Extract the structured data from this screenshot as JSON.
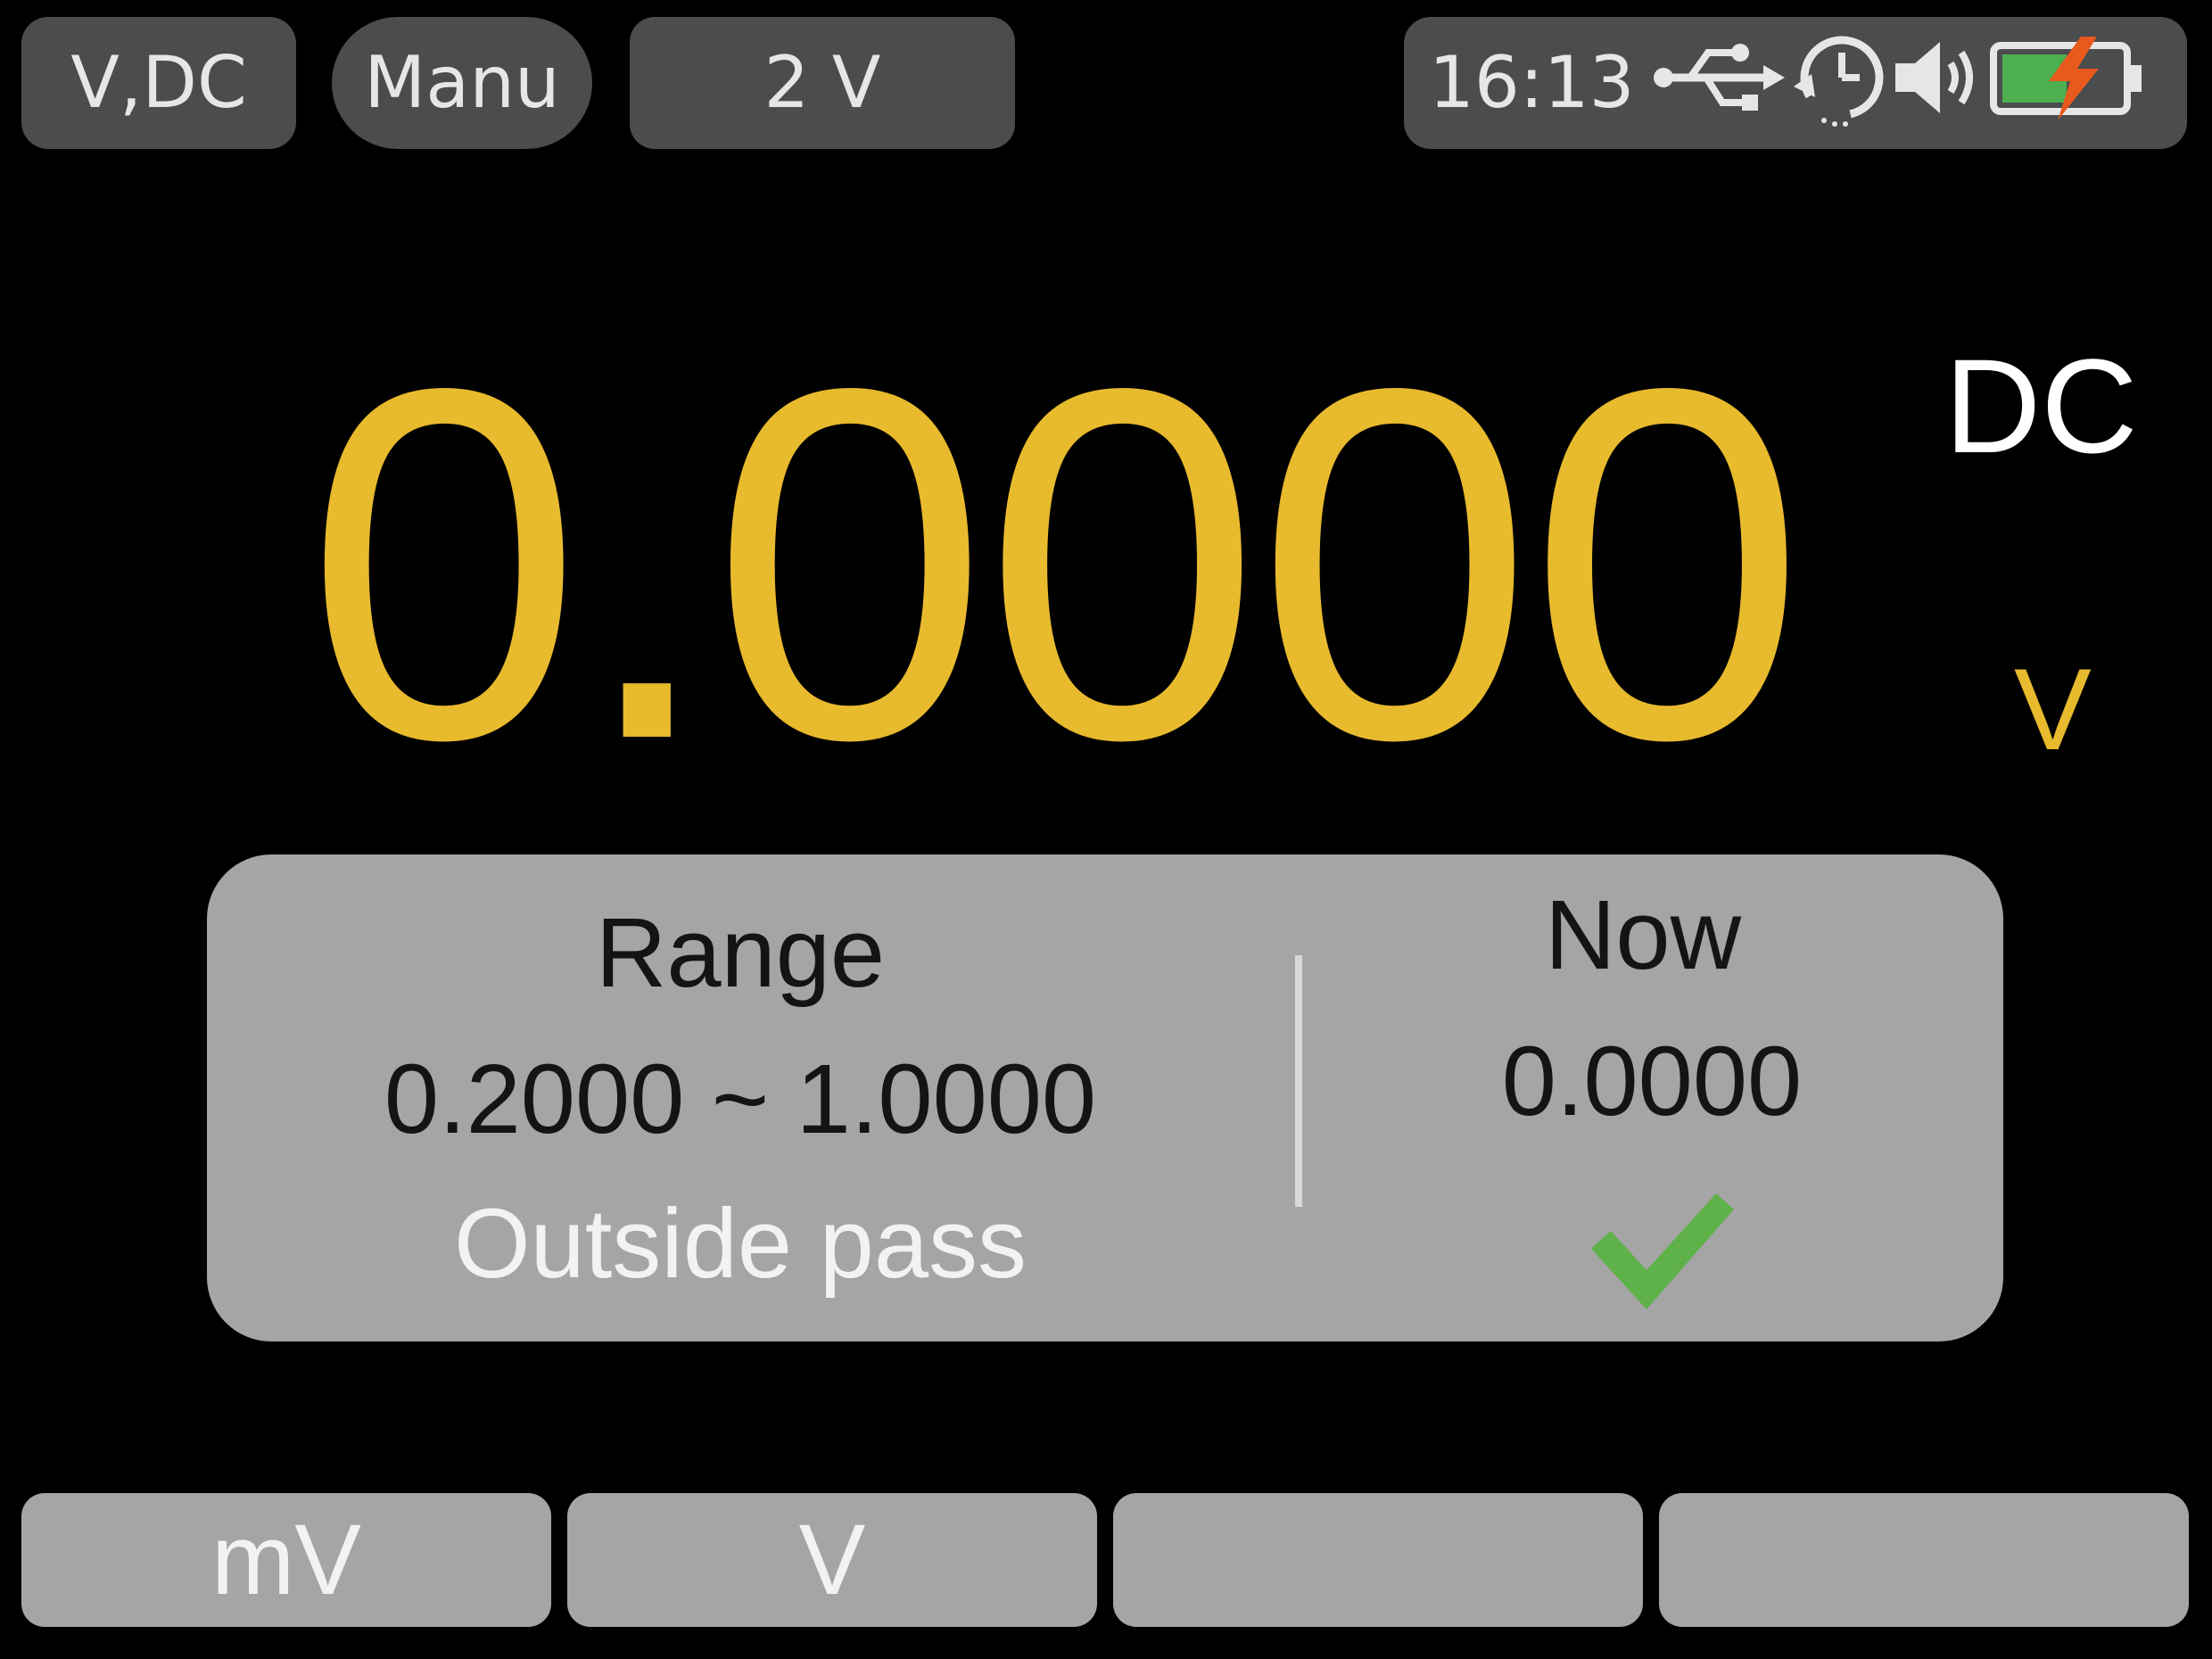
{
  "status_bar": {
    "function": "V,DC",
    "range_mode": "Manu",
    "range": "2 V",
    "time": "16:13",
    "icons": [
      "usb-icon",
      "auto-power-off-timer-icon",
      "speaker-icon",
      "battery-charging-icon"
    ]
  },
  "measurement": {
    "reading": "0.0000",
    "coupling": "DC",
    "unit": "V"
  },
  "limit_panel": {
    "range_title": "Range",
    "range_value": "0.2000 ~ 1.0000",
    "mode": "Outside pass",
    "now_title": "Now",
    "now_value": "0.0000",
    "result_icon": "check-icon"
  },
  "softkeys": [
    "mV",
    "V",
    "",
    ""
  ],
  "colors": {
    "reading": "#e8ba2d",
    "pill": "#4a4c4e",
    "panel": "#a5a5a5",
    "pass_check": "#5fb14a",
    "battery_fill": "#4caf50",
    "charge_bolt": "#e85a1c"
  }
}
